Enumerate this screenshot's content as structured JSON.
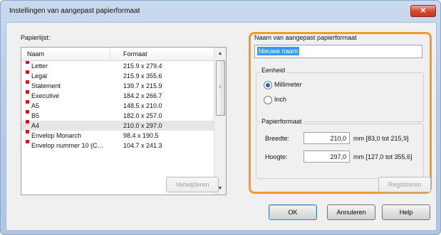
{
  "window": {
    "title": "Instellingen van aangepast papierformaat",
    "close_glyph": "✕"
  },
  "paperlist": {
    "label": "Papierlijst:",
    "columns": {
      "name": "Naam",
      "format": "Formaat"
    },
    "rows": [
      {
        "name": "Letter",
        "format": "215.9 x 279.4"
      },
      {
        "name": "Legal",
        "format": "215.9 x 355.6"
      },
      {
        "name": "Statement",
        "format": "139.7 x 215.9"
      },
      {
        "name": "Executive",
        "format": "184.2 x 266.7"
      },
      {
        "name": "A5",
        "format": "148.5 x 210.0"
      },
      {
        "name": "B5",
        "format": "182.0 x 257.0"
      },
      {
        "name": "A4",
        "format": "210.0 x 297.0"
      },
      {
        "name": "Envelop Monarch",
        "format": "98.4 x 190.5"
      },
      {
        "name": "Envelop nummer 10 (C…",
        "format": "104.7 x 241.3"
      }
    ],
    "delete_label": "Verwijderen"
  },
  "custom": {
    "name_label": "Naam van aangepast papierformaat",
    "name_value": "Nieuwe naam",
    "unit": {
      "label": "Eenheid",
      "options": [
        "Millimeter",
        "Inch"
      ],
      "selected": "Millimeter"
    },
    "paperformat": {
      "label": "Papierformaat",
      "width": {
        "label": "Breedte:",
        "value": "210,0",
        "range": "mm [83,0 tot 215,9]"
      },
      "height": {
        "label": "Hoogte:",
        "value": "297,0",
        "range": "mm [127,0 tot 355,6]"
      }
    },
    "register_label": "Registreren"
  },
  "footer": {
    "ok": "OK",
    "cancel": "Annuleren",
    "help": "Help"
  },
  "colors": {
    "highlight": "#f39a2a",
    "selection": "#3399ff",
    "list_icon": "#d11111"
  }
}
